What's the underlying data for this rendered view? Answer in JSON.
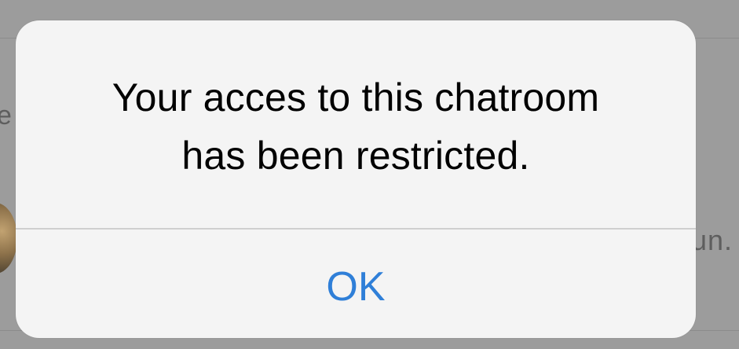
{
  "background": {
    "partial_left_text": "e",
    "partial_right_text": "un."
  },
  "alert": {
    "message_line1": "Your acces to this chatroom",
    "message_line2": "has been restricted.",
    "ok_label": "OK"
  },
  "colors": {
    "overlay": "#9a9a9a",
    "alert_bg": "#f4f4f4",
    "button_text": "#2f7fd8",
    "message_text": "#000000"
  }
}
